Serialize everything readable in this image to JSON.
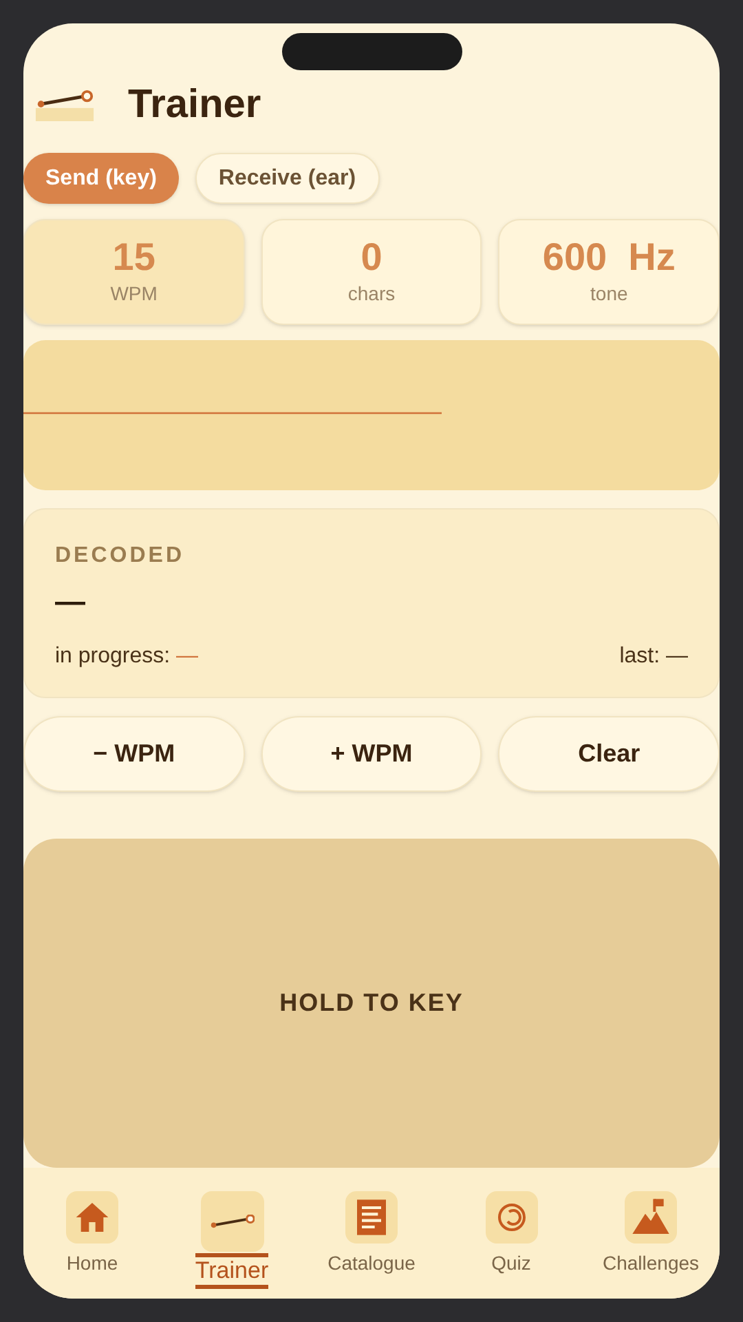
{
  "header": {
    "title": "Trainer"
  },
  "modes": [
    {
      "label": "Send (key)",
      "selected": true
    },
    {
      "label": "Receive (ear)",
      "selected": false
    }
  ],
  "stats": [
    {
      "value": "15",
      "label": "WPM"
    },
    {
      "value": "0",
      "label": "chars"
    },
    {
      "value": "600  Hz",
      "label": "tone"
    }
  ],
  "decoded": {
    "heading": "DECODED",
    "text": "—",
    "in_progress_label": "in progress:",
    "in_progress_value": "—",
    "last_label": "last:",
    "last_value": "—"
  },
  "actions": [
    "− WPM",
    "+ WPM",
    "Clear"
  ],
  "key_pad": {
    "label": "HOLD TO KEY"
  },
  "nav": [
    {
      "label": "Home",
      "kind": "home",
      "selected": false
    },
    {
      "label": "Trainer",
      "kind": "key",
      "selected": true
    },
    {
      "label": "Catalogue",
      "kind": "doc",
      "selected": false
    },
    {
      "label": "Quiz",
      "kind": "quiz",
      "selected": false
    },
    {
      "label": "Challenges",
      "kind": "flag",
      "selected": false
    }
  ]
}
